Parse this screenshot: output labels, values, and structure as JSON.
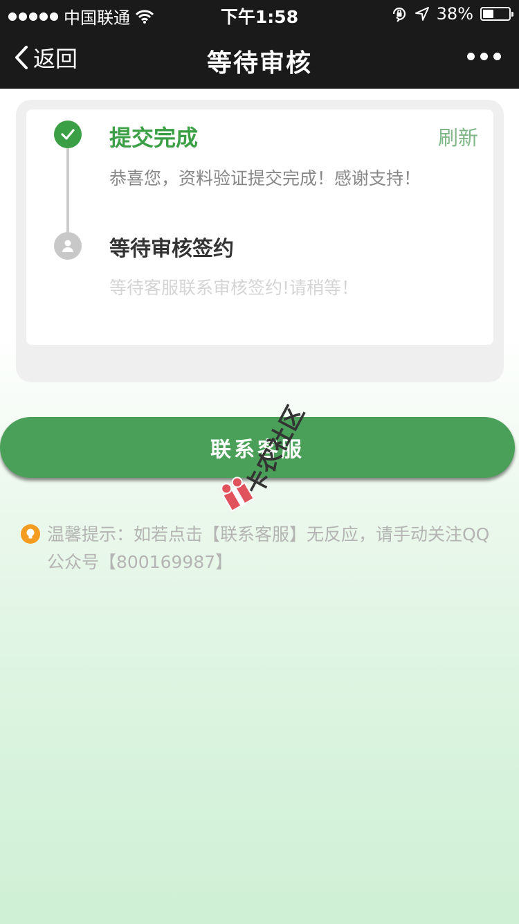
{
  "status_bar": {
    "carrier": "中国联通",
    "time": "下午1:58",
    "battery_text": "38%",
    "battery_level": 0.38
  },
  "nav": {
    "back_label": "返回",
    "title": "等待审核"
  },
  "steps": [
    {
      "title": "提交完成",
      "description": "恭喜您，资料验证提交完成！感谢支持！",
      "status": "done"
    },
    {
      "title": "等待审核签约",
      "description": "等待客服联系审核签约!请稍等！",
      "status": "pending"
    }
  ],
  "refresh_label": "刷新",
  "contact_button_label": "联系客服",
  "tip": {
    "text": "温馨提示：如若点击【联系客服】无反应，请手动关注QQ公众号【800169987】"
  },
  "watermark": {
    "text": "卡农社区"
  },
  "colors": {
    "primary_green": "#4aa058",
    "step_done": "#3a9f45",
    "refresh": "#7fb686",
    "tip_icon": "#f39c1f",
    "nav_background": "#1a1a1a"
  },
  "icons": {
    "back": "chevron-left-icon",
    "more": "more-dots-icon",
    "step_done": "check-icon",
    "step_pending": "person-icon",
    "tip": "lightbulb-icon",
    "wifi": "wifi-icon",
    "lock": "orientation-lock-icon",
    "location": "location-arrow-icon",
    "battery": "battery-icon"
  }
}
